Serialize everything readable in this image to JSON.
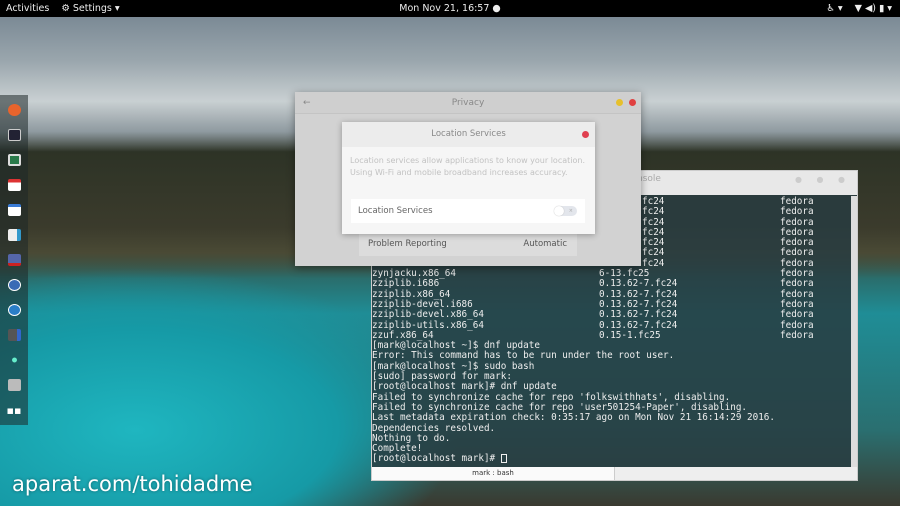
{
  "topbar": {
    "activities": "Activities",
    "settings_menu": "⚙ Settings ▾",
    "clock": "Mon Nov 21, 16:57 ●",
    "accessibility": "♿ ▾",
    "status": "▼ ◀) ▮ ▾"
  },
  "dock": {
    "items": [
      "Firefox",
      "Terminal",
      "Rhythmbox",
      "Calendar",
      "Files",
      "Software",
      "Screenshot",
      "Videos",
      "Shotwell",
      "Gimp",
      "Settings",
      "Notes",
      "Show Applications"
    ]
  },
  "terminal": {
    "title": "nsole",
    "buttons": "● ● ●",
    "pkg_rows_partial": [
      {
        "version": "fc24",
        "repo": "fedora"
      },
      {
        "version": "fc24",
        "repo": "fedora"
      },
      {
        "version": "fc24",
        "repo": "fedora"
      },
      {
        "version": "fc24",
        "repo": "fedora"
      },
      {
        "version": "fc24",
        "repo": "fedora"
      },
      {
        "version": "fc24",
        "repo": "fedora"
      },
      {
        "version": "fc24",
        "repo": "fedora"
      }
    ],
    "pkg_rows": [
      {
        "name": "zynjacku.x86_64",
        "version": "6-13.fc25",
        "repo": "fedora"
      },
      {
        "name": "zziplib.i686",
        "version": "0.13.62-7.fc24",
        "repo": "fedora"
      },
      {
        "name": "zziplib.x86_64",
        "version": "0.13.62-7.fc24",
        "repo": "fedora"
      },
      {
        "name": "zziplib-devel.i686",
        "version": "0.13.62-7.fc24",
        "repo": "fedora"
      },
      {
        "name": "zziplib-devel.x86_64",
        "version": "0.13.62-7.fc24",
        "repo": "fedora"
      },
      {
        "name": "zziplib-utils.x86_64",
        "version": "0.13.62-7.fc24",
        "repo": "fedora"
      },
      {
        "name": "zzuf.x86_64",
        "version": "0.15-1.fc25",
        "repo": "fedora"
      }
    ],
    "lines": [
      "[mark@localhost ~]$ dnf update",
      "Error: This command has to be run under the root user.",
      "[mark@localhost ~]$ sudo bash",
      "[sudo] password for mark:",
      "[root@localhost mark]# dnf update",
      "Failed to synchronize cache for repo 'folkswithhats', disabling.",
      "Failed to synchronize cache for repo 'user501254-Paper', disabling.",
      "Last metadata expiration check: 0:35:17 ago on Mon Nov 21 16:14:29 2016.",
      "Dependencies resolved.",
      "Nothing to do.",
      "Complete!"
    ],
    "prompt": "[root@localhost mark]# ",
    "tab": "mark : bash"
  },
  "privacy": {
    "title": "Privacy",
    "back": "←",
    "problem_reporting": "Problem Reporting",
    "problem_reporting_value": "Automatic"
  },
  "location": {
    "title": "Location Services",
    "description": "Location services allow applications to know your location. Using Wi-Fi and mobile broadband increases accuracy.",
    "option_label": "Location Services",
    "toggle_on": false,
    "toggle_mark": "×"
  },
  "watermark": "aparat.com/tohidadme"
}
